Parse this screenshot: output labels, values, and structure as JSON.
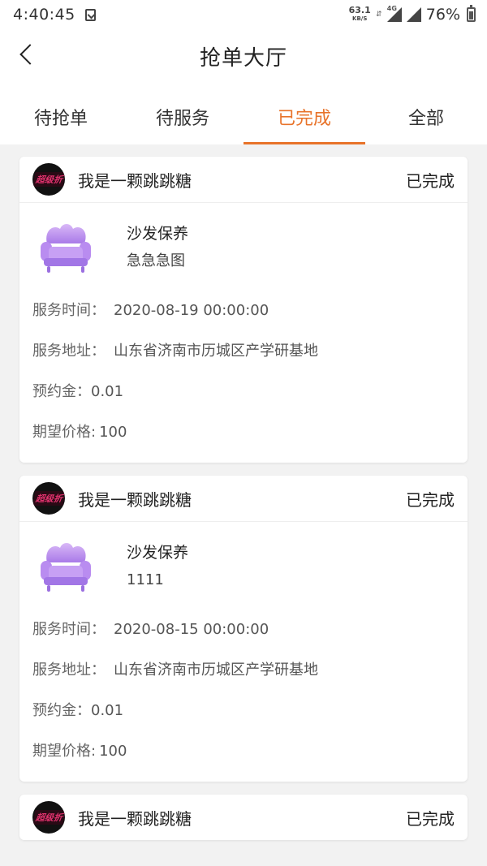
{
  "status_bar": {
    "time": "4:40:45",
    "net_speed": "63.1",
    "net_unit": "KB/S",
    "network_type": "4G",
    "battery": "76%"
  },
  "nav": {
    "title": "抢单大厅"
  },
  "tabs": [
    {
      "label": "待抢单",
      "active": false
    },
    {
      "label": "待服务",
      "active": false
    },
    {
      "label": "已完成",
      "active": true
    },
    {
      "label": "全部",
      "active": false
    }
  ],
  "avatar_text": "超级折",
  "orders": [
    {
      "user": "我是一颗跳跳糖",
      "status": "已完成",
      "service": "沙发保养",
      "desc": "急急急图",
      "time_label": "服务时间：",
      "time": "2020-08-19 00:00:00",
      "addr_label": "服务地址：",
      "addr": "山东省济南市历城区产学研基地",
      "deposit_label": "预约金：",
      "deposit": "0.01",
      "price_label": "期望价格:",
      "price": "100"
    },
    {
      "user": "我是一颗跳跳糖",
      "status": "已完成",
      "service": "沙发保养",
      "desc": "1111",
      "time_label": "服务时间：",
      "time": "2020-08-15 00:00:00",
      "addr_label": "服务地址：",
      "addr": "山东省济南市历城区产学研基地",
      "deposit_label": "预约金：",
      "deposit": "0.01",
      "price_label": "期望价格:",
      "price": "100"
    },
    {
      "user": "我是一颗跳跳糖",
      "status": "已完成"
    }
  ],
  "colors": {
    "accent": "#e8732a",
    "sofa": "#b98cf0"
  }
}
